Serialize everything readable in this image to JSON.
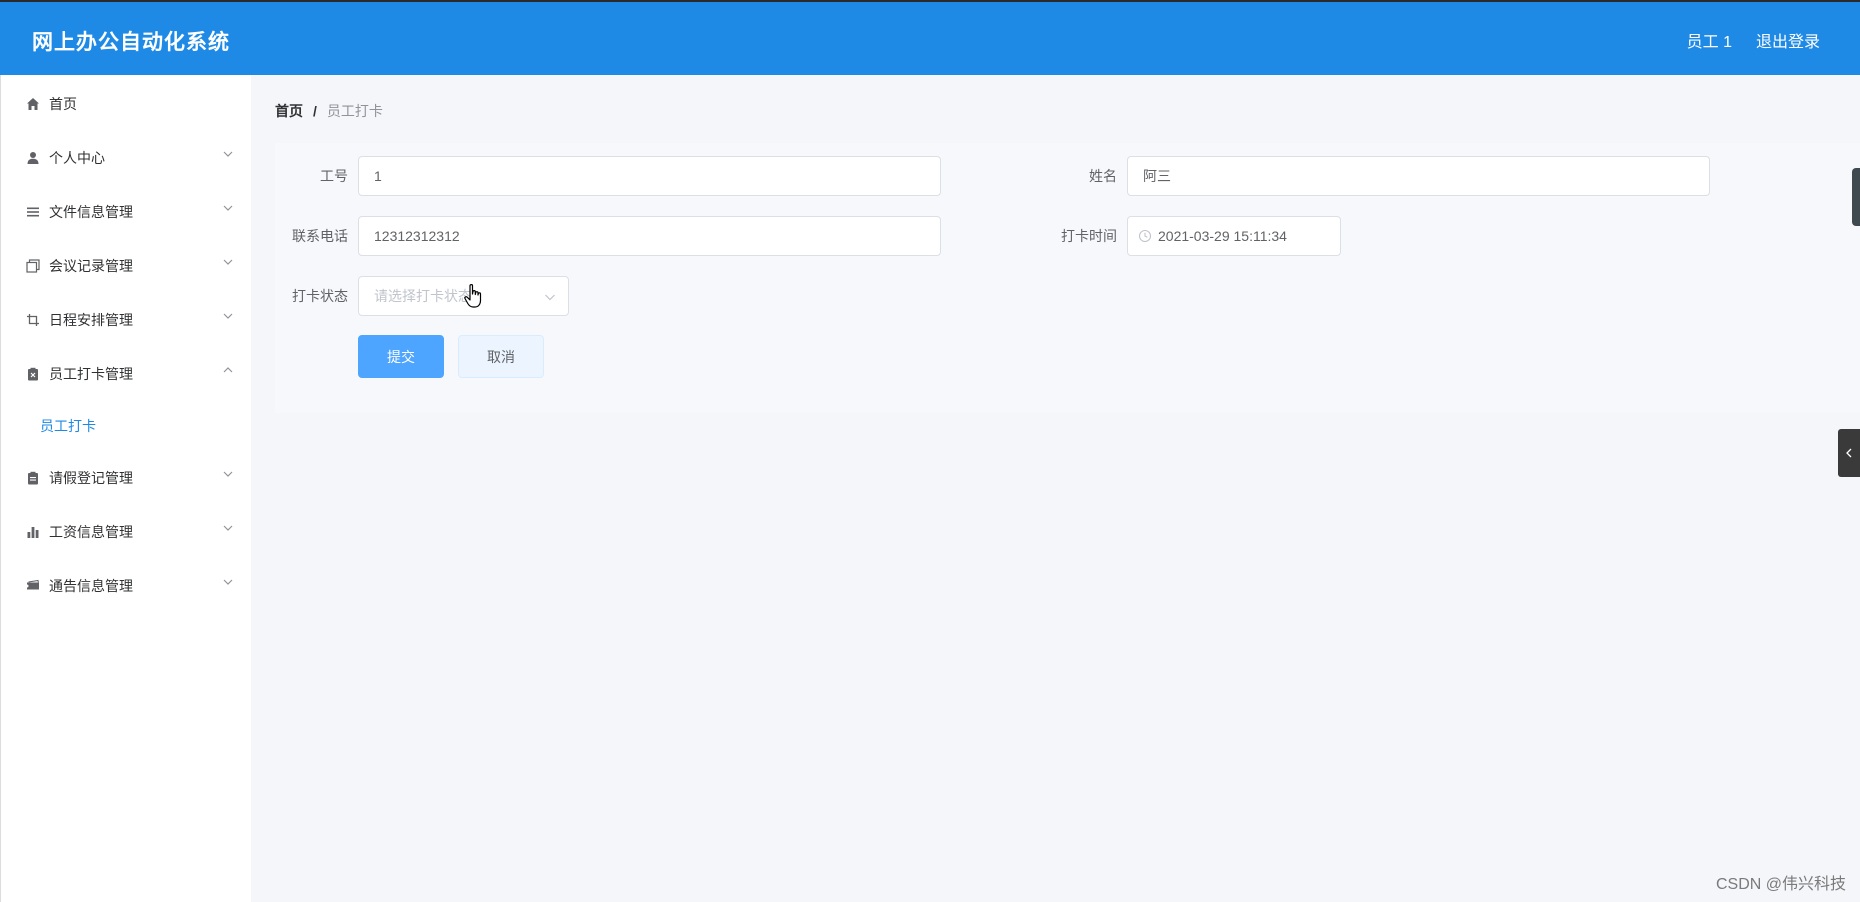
{
  "header": {
    "app_title": "网上办公自动化系统",
    "user_label": "员工 1",
    "logout_label": "退出登录",
    "accent_color": "#1f8ae6"
  },
  "sidebar": {
    "items": [
      {
        "label": "首页",
        "icon": "home-icon"
      },
      {
        "label": "个人中心",
        "icon": "user-icon"
      },
      {
        "label": "文件信息管理",
        "icon": "list-icon"
      },
      {
        "label": "会议记录管理",
        "icon": "copy-icon"
      },
      {
        "label": "日程安排管理",
        "icon": "crop-icon"
      },
      {
        "label": "员工打卡管理",
        "icon": "clipboard-icon"
      },
      {
        "label": "请假登记管理",
        "icon": "document-icon"
      },
      {
        "label": "工资信息管理",
        "icon": "bar-chart-icon"
      },
      {
        "label": "通告信息管理",
        "icon": "ticket-icon"
      }
    ],
    "submenu": {
      "label": "员工打卡"
    }
  },
  "breadcrumb": {
    "home": "首页",
    "separator": "/",
    "current": "员工打卡"
  },
  "form": {
    "employee_no_label": "工号",
    "employee_no_value": "1",
    "name_label": "姓名",
    "name_value": "阿三",
    "phone_label": "联系电话",
    "phone_value": "12312312312",
    "time_label": "打卡时间",
    "time_value": "2021-03-29 15:11:34",
    "status_label": "打卡状态",
    "status_placeholder": "请选择打卡状态",
    "submit_label": "提交",
    "cancel_label": "取消"
  },
  "watermark": "CSDN @伟兴科技"
}
